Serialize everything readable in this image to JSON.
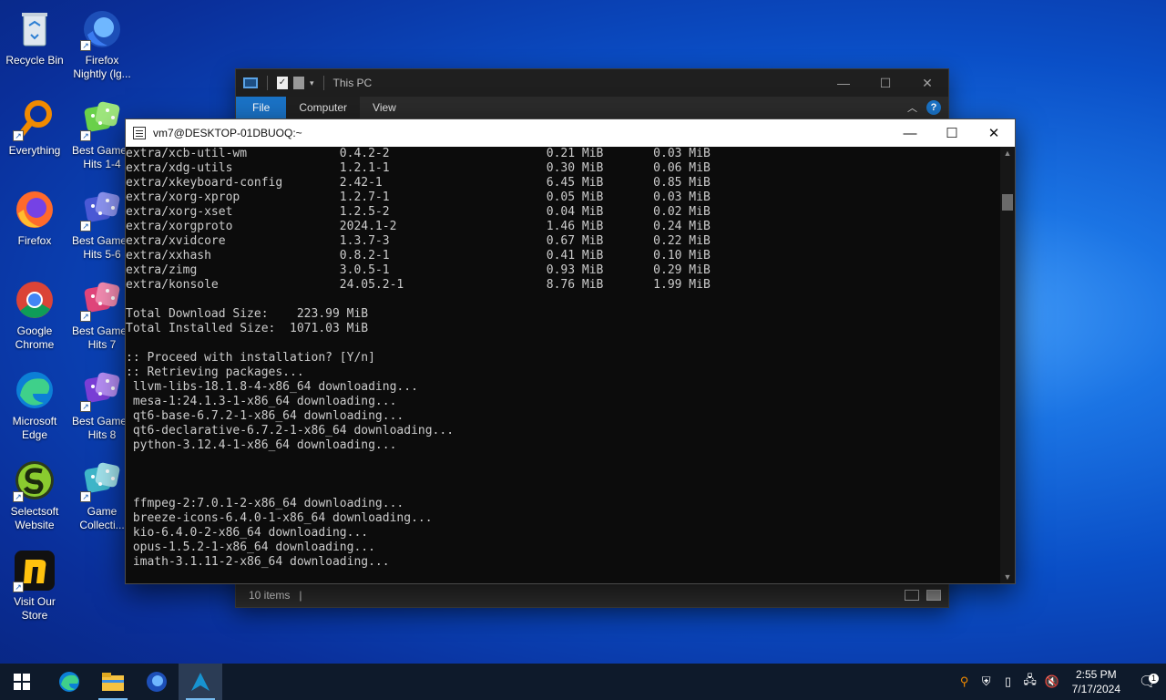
{
  "desktop": {
    "icons": [
      {
        "label": "Recycle Bin",
        "icon": "recycle-bin-icon"
      },
      {
        "label": "Firefox Nightly (lg...",
        "icon": "firefox-nightly-icon"
      },
      {
        "label": "Everything",
        "icon": "everything-search-icon"
      },
      {
        "label": "Best Games Hits 1-4",
        "icon": "dice-icon"
      },
      {
        "label": "Firefox",
        "icon": "firefox-icon"
      },
      {
        "label": "Best Games Hits 5-6",
        "icon": "dice-icon"
      },
      {
        "label": "Google Chrome",
        "icon": "chrome-icon"
      },
      {
        "label": "Best Games Hits 7",
        "icon": "dice-icon"
      },
      {
        "label": "Microsoft Edge",
        "icon": "edge-icon"
      },
      {
        "label": "Best Games Hits 8",
        "icon": "dice-icon"
      },
      {
        "label": "Selectsoft Website",
        "icon": "selectsoft-icon"
      },
      {
        "label": "Game Collecti...",
        "icon": "dice-icon"
      },
      {
        "label": "Visit Our Store",
        "icon": "store-icon"
      }
    ]
  },
  "explorer": {
    "title": "This PC",
    "tabs": [
      "File",
      "Computer",
      "View"
    ],
    "status": "10 items",
    "status_sep": "|"
  },
  "terminal": {
    "title": "vm7@DESKTOP-01DBUOQ:~",
    "lines": [
      "extra/xcb-util-wm             0.4.2-2                      0.21 MiB       0.03 MiB",
      "extra/xdg-utils               1.2.1-1                      0.30 MiB       0.06 MiB",
      "extra/xkeyboard-config        2.42-1                       6.45 MiB       0.85 MiB",
      "extra/xorg-xprop              1.2.7-1                      0.05 MiB       0.03 MiB",
      "extra/xorg-xset               1.2.5-2                      0.04 MiB       0.02 MiB",
      "extra/xorgproto               2024.1-2                     1.46 MiB       0.24 MiB",
      "extra/xvidcore                1.3.7-3                      0.67 MiB       0.22 MiB",
      "extra/xxhash                  0.8.2-1                      0.41 MiB       0.10 MiB",
      "extra/zimg                    3.0.5-1                      0.93 MiB       0.29 MiB",
      "extra/konsole                 24.05.2-1                    8.76 MiB       1.99 MiB",
      "",
      "Total Download Size:    223.99 MiB",
      "Total Installed Size:  1071.03 MiB",
      "",
      ":: Proceed with installation? [Y/n]",
      ":: Retrieving packages...",
      " llvm-libs-18.1.8-4-x86_64 downloading...",
      " mesa-1:24.1.3-1-x86_64 downloading...",
      " qt6-base-6.7.2-1-x86_64 downloading...",
      " qt6-declarative-6.7.2-1-x86_64 downloading...",
      " python-3.12.4-1-x86_64 downloading...",
      "",
      "",
      "",
      " ffmpeg-2:7.0.1-2-x86_64 downloading...",
      " breeze-icons-6.4.0-1-x86_64 downloading...",
      " kio-6.4.0-2-x86_64 downloading...",
      " opus-1.5.2-1-x86_64 downloading...",
      " imath-3.1.11-2-x86_64 downloading..."
    ]
  },
  "taskbar": {
    "apps": [
      "start-icon",
      "edge-icon",
      "file-explorer-icon",
      "firefox-icon",
      "arch-terminal-icon"
    ],
    "time": "2:55 PM",
    "date": "7/17/2024",
    "notification_count": "1"
  },
  "colors": {
    "terminal_bg": "#0c0c0c",
    "terminal_fg": "#cccccc",
    "taskbar_bg": "#0e1a2b",
    "accent": "#1a73c7"
  }
}
